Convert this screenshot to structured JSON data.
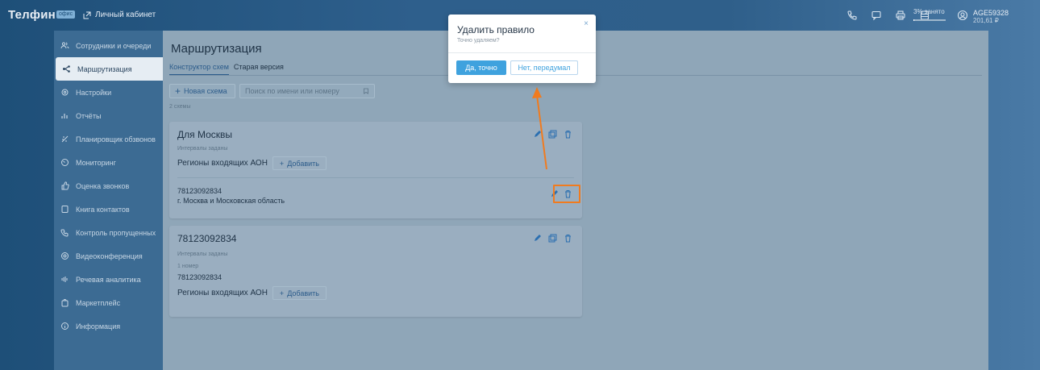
{
  "topbar": {
    "logo": "Телфин",
    "logo_badge": "офис",
    "cabinet_label": "Личный кабинет",
    "busy_text": "3% занято",
    "busy_percent": 3,
    "account_id": "AGE59328",
    "balance": "201,61 ₽",
    "icons": [
      "phone-icon",
      "chat-icon",
      "fax-icon",
      "database-icon",
      "user-icon"
    ]
  },
  "sidebar": {
    "items": [
      {
        "label": "Сотрудники и очереди",
        "icon": "people-icon",
        "active": false
      },
      {
        "label": "Маршрутизация",
        "icon": "routing-icon",
        "active": true
      },
      {
        "label": "Настройки",
        "icon": "gear-icon",
        "active": false
      },
      {
        "label": "Отчёты",
        "icon": "bars-icon",
        "active": false
      },
      {
        "label": "Планировщик обзвонов",
        "icon": "scheduler-icon",
        "active": false
      },
      {
        "label": "Мониторинг",
        "icon": "monitor-icon",
        "active": false
      },
      {
        "label": "Оценка звонков",
        "icon": "thumb-icon",
        "active": false
      },
      {
        "label": "Книга контактов",
        "icon": "book-icon",
        "active": false
      },
      {
        "label": "Контроль пропущенных",
        "icon": "missed-call-icon",
        "active": false
      },
      {
        "label": "Видеоконференция",
        "icon": "camera-icon",
        "active": false
      },
      {
        "label": "Речевая аналитика",
        "icon": "voice-icon",
        "active": false
      },
      {
        "label": "Маркетплейс",
        "icon": "bag-icon",
        "active": false
      },
      {
        "label": "Информация",
        "icon": "info-icon",
        "active": false
      }
    ]
  },
  "main": {
    "title": "Маршрутизация",
    "tabs": [
      {
        "label": "Конструктор схем",
        "active": true
      },
      {
        "label": "Старая версия",
        "active": false
      }
    ],
    "new_button": "Новая схема",
    "search_placeholder": "Поиск по имени или номеру",
    "count": "2 схемы",
    "cards": [
      {
        "title": "Для Москвы",
        "intervals": "Интервалы заданы",
        "regions_label": "Регионы входящих АОН",
        "add_label": "Добавить",
        "rule_number": "78123092834",
        "rule_region": "г. Москва и Московская область"
      },
      {
        "title": "78123092834",
        "intervals": "Интервалы заданы",
        "numbers_count": "1 номер",
        "number": "78123092834",
        "regions_label": "Регионы входящих АОН",
        "add_label": "Добавить"
      }
    ]
  },
  "modal": {
    "title": "Удалить правило",
    "subtitle": "Точно удаляем?",
    "confirm": "Да, точно",
    "cancel": "Нет, передумал",
    "close": "×"
  },
  "colors": {
    "accent": "#3fa2de",
    "annotation": "#f07b1f"
  }
}
